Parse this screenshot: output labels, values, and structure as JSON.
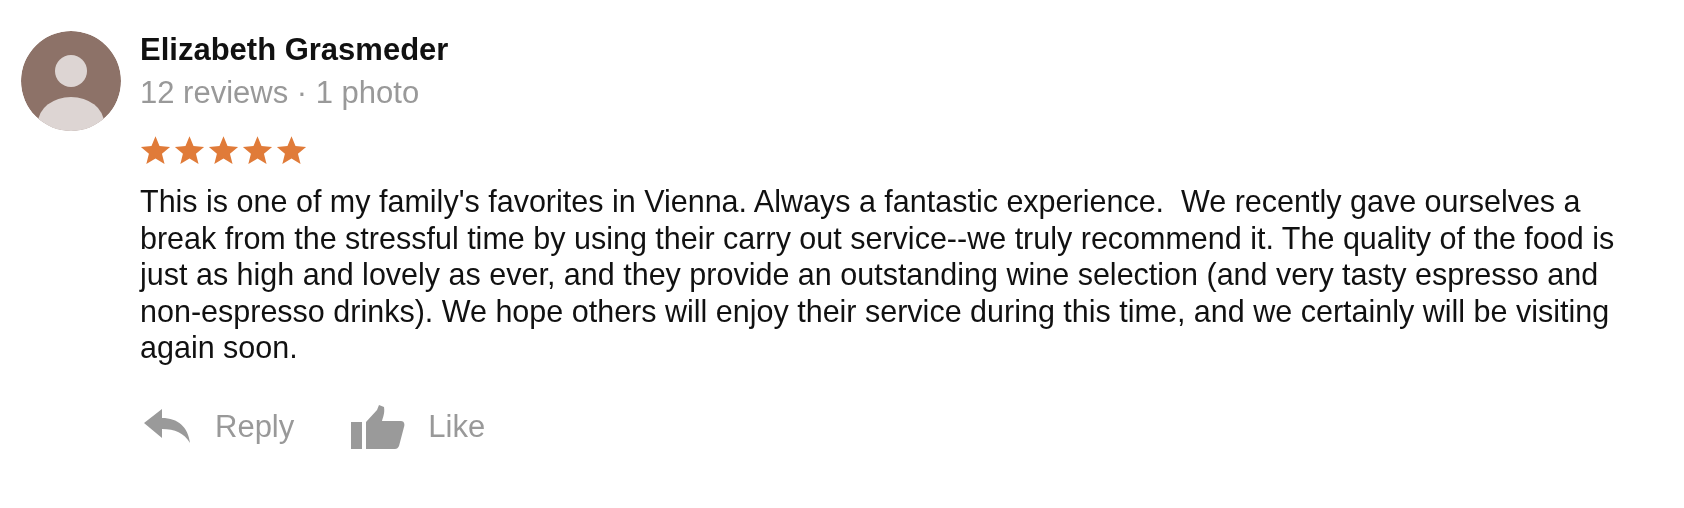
{
  "review": {
    "author": "Elizabeth Grasmeder",
    "meta": "12 reviews · 1 photo",
    "stars": 5,
    "text": "This is one of my family's favorites in Vienna. Always a fantastic experience.  We recently gave ourselves a break from the stressful time by using their carry out service--we truly recommend it. The quality of the food is just as high and lovely as ever, and they provide an outstanding wine selection (and very tasty espresso and non-espresso drinks). We hope others will enjoy their service during this time, and we certainly will be visiting again soon.",
    "actions": [
      {
        "kind": "reply",
        "label": "Reply"
      },
      {
        "kind": "like",
        "label": "Like"
      }
    ]
  }
}
